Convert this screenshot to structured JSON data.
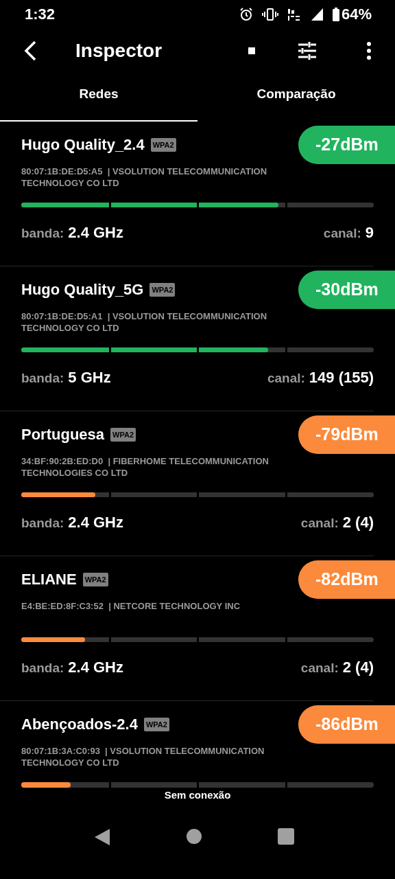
{
  "status_bar": {
    "time": "1:32",
    "battery": "64%"
  },
  "toolbar": {
    "title": "Inspector"
  },
  "tabs": [
    {
      "label": "Redes",
      "selected": true
    },
    {
      "label": "Comparação",
      "selected": false
    }
  ],
  "networks": [
    {
      "ssid": "Hugo Quality_2.4",
      "security": "WPA2",
      "signal": "-27dBm",
      "color": "#22b35e",
      "details": "80:07:1B:DE:D5:A5  | VSOLUTION TELECOMMUNICATION TECHNOLOGY CO LTD",
      "level": 0.73,
      "band_label": "banda:",
      "band": "2.4 GHz",
      "channel_label": "canal:",
      "channel": "9"
    },
    {
      "ssid": "Hugo Quality_5G",
      "security": "WPA2",
      "signal": "-30dBm",
      "color": "#22b35e",
      "details": "80:07:1B:DE:D5:A1  | VSOLUTION TELECOMMUNICATION TECHNOLOGY CO LTD",
      "level": 0.7,
      "band_label": "banda:",
      "band": "5 GHz",
      "channel_label": "canal:",
      "channel": "149 (155)"
    },
    {
      "ssid": "Portuguesa",
      "security": "WPA2",
      "signal": "-79dBm",
      "color": "#fb8a3c",
      "details": "34:BF:90:2B:ED:D0  | FIBERHOME TELECOMMUNICATION TECHNOLOGIES CO LTD",
      "level": 0.21,
      "band_label": "banda:",
      "band": "2.4 GHz",
      "channel_label": "canal:",
      "channel": "2 (4)"
    },
    {
      "ssid": "ELIANE",
      "security": "WPA2",
      "signal": "-82dBm",
      "color": "#fb8a3c",
      "details": "E4:BE:ED:8F:C3:52  | NETCORE TECHNOLOGY INC",
      "level": 0.18,
      "band_label": "banda:",
      "band": "2.4 GHz",
      "channel_label": "canal:",
      "channel": "2 (4)"
    },
    {
      "ssid": "Abençoados-2.4",
      "security": "WPA2",
      "signal": "-86dBm",
      "color": "#fb8a3c",
      "details": "80:07:1B:3A:C0:93  | VSOLUTION TELECOMMUNICATION TECHNOLOGY CO LTD",
      "level": 0.14
    }
  ],
  "footer": {
    "text": "Sem conexão"
  }
}
